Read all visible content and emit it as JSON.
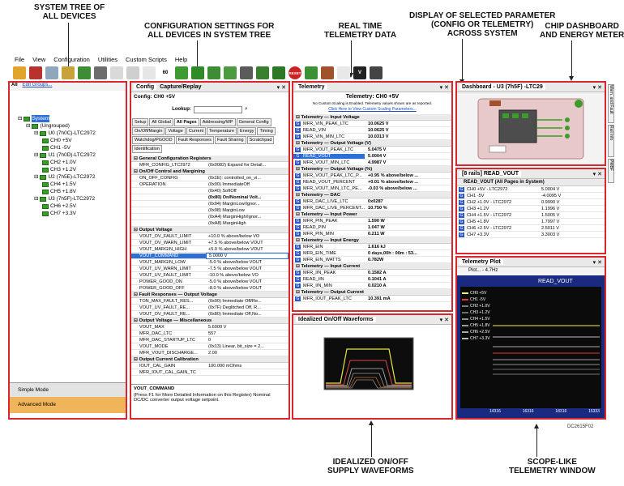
{
  "callouts": {
    "system_tree": [
      "SYSTEM TREE OF",
      "ALL DEVICES"
    ],
    "config_settings": [
      "CONFIGURATION SETTINGS FOR",
      "ALL DEVICES IN SYSTEM TREE"
    ],
    "realtime": [
      "REAL TIME",
      "TELEMETRY DATA"
    ],
    "selected_param": [
      "DISPLAY OF SELECTED PARAMETER",
      "(CONFIG OR TELEMETRY)",
      "ACROSS SYSTEM"
    ],
    "dashboard": [
      "CHIP DASHBOARD",
      "AND ENERGY METER"
    ],
    "waveforms": [
      "IDEALIZED ON/OFF",
      "SUPPLY WAVEFORMS"
    ],
    "scope": [
      "SCOPE-LIKE",
      "TELEMETRY WINDOW"
    ],
    "fig_id": "DC2615F02"
  },
  "menu": [
    "File",
    "View",
    "Configuration",
    "Utilities",
    "Custom Scripts",
    "Help"
  ],
  "toolbar_labels": {
    "reset": "RESET",
    "v": "V",
    "zoom": "60"
  },
  "tree": {
    "header_all": "All",
    "header_edit": "Edit Groups...",
    "nodes": [
      {
        "label": "System",
        "depth": 0
      },
      {
        "label": "(Ungrouped)",
        "depth": 1
      },
      {
        "label": "U0 (7h0C)-LTC2972",
        "depth": 2
      },
      {
        "label": "CH0 +5V",
        "depth": 3
      },
      {
        "label": "CH1 -5V",
        "depth": 3
      },
      {
        "label": "U1 (7h0D)-LTC2972",
        "depth": 2
      },
      {
        "label": "CH2 +1.0V",
        "depth": 3
      },
      {
        "label": "CH3 +1.2V",
        "depth": 3
      },
      {
        "label": "U2 (7h5E)-LTC2972",
        "depth": 2
      },
      {
        "label": "CH4 +1.5V",
        "depth": 3
      },
      {
        "label": "CH5 +1.8V",
        "depth": 3
      },
      {
        "label": "U3 (7h5F)-LTC2972",
        "depth": 2
      },
      {
        "label": "CH6 +2.5V",
        "depth": 3
      },
      {
        "label": "CH7 +3.3V",
        "depth": 3
      }
    ],
    "simple_mode": "Simple Mode",
    "advanced_mode": "Advanced Mode"
  },
  "config": {
    "tab_config": "Config",
    "tab_capture": "Capture/Replay",
    "subtitle": "Config: CH0 +5V",
    "lookup": "Lookup:",
    "tabs": [
      "Setup",
      "All Global",
      "All Pages",
      "Addressing/WP",
      "General Config",
      "On/Off/Margin",
      "Voltage",
      "Current",
      "Temperature",
      "Energy",
      "Timing",
      "Watchdog/PGOOD",
      "Fault Responses",
      "Fault Sharing",
      "Scratchpad",
      "Identification"
    ],
    "sections": [
      {
        "title": "General Configuration Registers",
        "rows": [
          [
            "MFR_CONFIG_LTC2972",
            "(0x0082) Expand for Detail..."
          ]
        ]
      },
      {
        "title": "On/Off Control and Margining",
        "rows": [
          [
            "ON_OFF_CONFIG",
            "(0x1E): controlled_on_vi..."
          ],
          [
            "OPERATION",
            "(0x00) ImmediateOff"
          ],
          [
            "",
            "(0x40) SoftOff"
          ],
          [
            "",
            "(0x80) On/Nominal Volt..."
          ],
          [
            "",
            "(0x94) MarginLow/Ignor..."
          ],
          [
            "",
            "(0x98) MarginLow"
          ],
          [
            "",
            "(0xA4) MarginHigh/Ignor..."
          ],
          [
            "",
            "(0xA8) MarginHigh"
          ]
        ]
      },
      {
        "title": "Output Voltage",
        "rows": [
          [
            "VOUT_OV_FAULT_LIMIT",
            "+10.0 % above/below VO"
          ],
          [
            "VOUT_OV_WARN_LIMIT",
            "+7.5 % above/below VOUT"
          ],
          [
            "VOUT_MARGIN_HIGH",
            "+5.0 % above/below VOUT"
          ],
          [
            "VOUT_COMMAND",
            "5.0000 V"
          ],
          [
            "VOUT_MARGIN_LOW",
            "-5.0 % above/below VOUT"
          ],
          [
            "VOUT_UV_WARN_LIMIT",
            "-7.5 % above/below VOUT"
          ],
          [
            "VOUT_UV_FAULT_LIMIT",
            "-10.0 % above/below VO"
          ],
          [
            "POWER_GOOD_ON",
            "-5.0 % above/below VOUT"
          ],
          [
            "POWER_GOOD_OFF",
            "-8.0 % above/below VOUT"
          ]
        ]
      },
      {
        "title": "Fault Responses — Output Voltage",
        "rows": [
          [
            "TON_MAX_FAULT_RES...",
            "(0x00) Immediate Off/Re..."
          ],
          [
            "VOUT_UV_FAULT_RE...",
            "(0x7F) Deglitched Off, R..."
          ],
          [
            "VOUT_OV_FAULT_RE...",
            "(0x80) Immediate Off,No..."
          ]
        ]
      },
      {
        "title": "Output Voltage — Miscellaneous",
        "rows": [
          [
            "VOUT_MAX",
            "5.6000 V"
          ],
          [
            "MFR_DAC_LTC",
            "557"
          ],
          [
            "MFR_DAC_STARTUP_LTC",
            "0"
          ],
          [
            "VOUT_MODE",
            "(0x13) Linear, bit_size = 2..."
          ],
          [
            "MFR_VOUT_DISCHARGE...",
            "2.00"
          ]
        ]
      },
      {
        "title": "Output Current Calibration",
        "rows": [
          [
            "IOUT_CAL_GAIN",
            "100.000 mOhms"
          ],
          [
            "MFR_IOUT_CAL_GAIN_TC",
            ""
          ]
        ]
      }
    ],
    "help_title": "VOUT_COMMAND",
    "help_text": "(Press F1 for More Detailed Information on this Register) Nominal DC/DC converter output voltage setpoint."
  },
  "telemetry": {
    "tab": "Telemetry",
    "header": "Telemetry: CH0 +5V",
    "note": "No Custom Scaling is Enabled. Telemetry values shown are as reported.",
    "link": "Click Here to View Custom Scaling Parameters...",
    "sections": [
      {
        "title": "Telemetry — Input Voltage",
        "rows": [
          [
            "MFR_VIN_PEAK_LTC",
            "10.0625 V"
          ],
          [
            "READ_VIN",
            "10.0625 V"
          ],
          [
            "MFR_VIN_MIN_LTC",
            "10.0313 V"
          ]
        ]
      },
      {
        "title": "Telemetry — Output Voltage (V)",
        "rows": [
          [
            "MFR_VOUT_PEAK_LTC",
            "5.0475 V"
          ],
          [
            "READ_VOUT",
            "5.0004 V"
          ],
          [
            "MFR_VOUT_MIN_LTC",
            "4.9987 V"
          ]
        ]
      },
      {
        "title": "Telemetry — Output Voltage (%)",
        "rows": [
          [
            "MFR_VOUT_PEAK_LTC_P...",
            "+0.95 % above/below ..."
          ],
          [
            "READ_VOUT_PERCENT",
            "+0.01 % above/below ..."
          ],
          [
            "MFR_VOUT_MIN_LTC_PE...",
            "-0.03 % above/below ..."
          ]
        ]
      },
      {
        "title": "Telemetry — DAC",
        "rows": [
          [
            "MFR_DAC_LIVE_LTC",
            "0x0287"
          ],
          [
            "MFR_DAC_LIVE_PERCENT...",
            "10.750 %"
          ]
        ]
      },
      {
        "title": "Telemetry — Input Power",
        "rows": [
          [
            "MFR_PIN_PEAK",
            "1.590 W"
          ],
          [
            "READ_PIN",
            "1.047 W"
          ],
          [
            "MFR_PIN_MIN",
            "0.211 W"
          ]
        ]
      },
      {
        "title": "Telemetry — Input Energy",
        "rows": [
          [
            "MFR_EIN",
            "1.616 kJ"
          ],
          [
            "MFR_EIN_TIME",
            "0 days,00h : 00m : 53..."
          ],
          [
            "MFR_EIN_WATTS",
            "0.782W"
          ]
        ]
      },
      {
        "title": "Telemetry — Input Current",
        "rows": [
          [
            "MFR_IIN_PEAK",
            "0.1582 A"
          ],
          [
            "READ_IIN",
            "0.1041 A"
          ],
          [
            "MFR_IIN_MIN",
            "0.0210 A"
          ]
        ]
      },
      {
        "title": "Telemetry — Output Current",
        "rows": [
          [
            "MFR_IOUT_PEAK_LTC",
            "10.391 mA"
          ]
        ]
      }
    ]
  },
  "waveforms": {
    "tab": "Idealized On/Off Waveforms"
  },
  "dashboard": {
    "tab": "Dashboard - U3 (7h5F) -LTC29"
  },
  "readvout": {
    "tab": "[8 rails] READ_VOUT",
    "header": "READ_VOUT (All Pages in System)",
    "rows": [
      [
        "CH0 +5V - LTC2972",
        "5.0004 V"
      ],
      [
        "CH1 -5V",
        "-4.0095 V"
      ],
      [
        "CH2 +1.0V - LTC2972",
        "0.9990 V"
      ],
      [
        "CH3 +1.2V",
        "1.1996 V"
      ],
      [
        "CH4 +1.5V - LTC2972",
        "1.5005 V"
      ],
      [
        "CH5 +1.8V",
        "1.7997 V"
      ],
      [
        "CH6 +2.5V - LTC2972",
        "2.5011 V"
      ],
      [
        "CH7 +3.3V",
        "3.3003 V"
      ]
    ]
  },
  "scope": {
    "tab": "Telemetry Plot",
    "toolbar": "Plot... - 4.7Hz",
    "title": "READ_VOUT",
    "legend": [
      "CH0 +5V",
      "CH1 -5V",
      "CH2 +1.0V",
      "CH3 +1.2V",
      "CH4 +1.5V",
      "CH5 +1.8V",
      "CH6 +2.5V",
      "CH7 +3.3V"
    ],
    "legend_colors": [
      "#f2f25a",
      "#e03838",
      "#7a7a7a",
      "#6e6e6e",
      "#8f8f8f",
      "#9a9a9a",
      "#a8a8a8",
      "#bcbcbc"
    ],
    "xticks": [
      "14316",
      "16316",
      "18316",
      "15333"
    ]
  },
  "side_tabs": [
    "Warn. and Fault",
    "Rail Info",
    "PMBF"
  ]
}
